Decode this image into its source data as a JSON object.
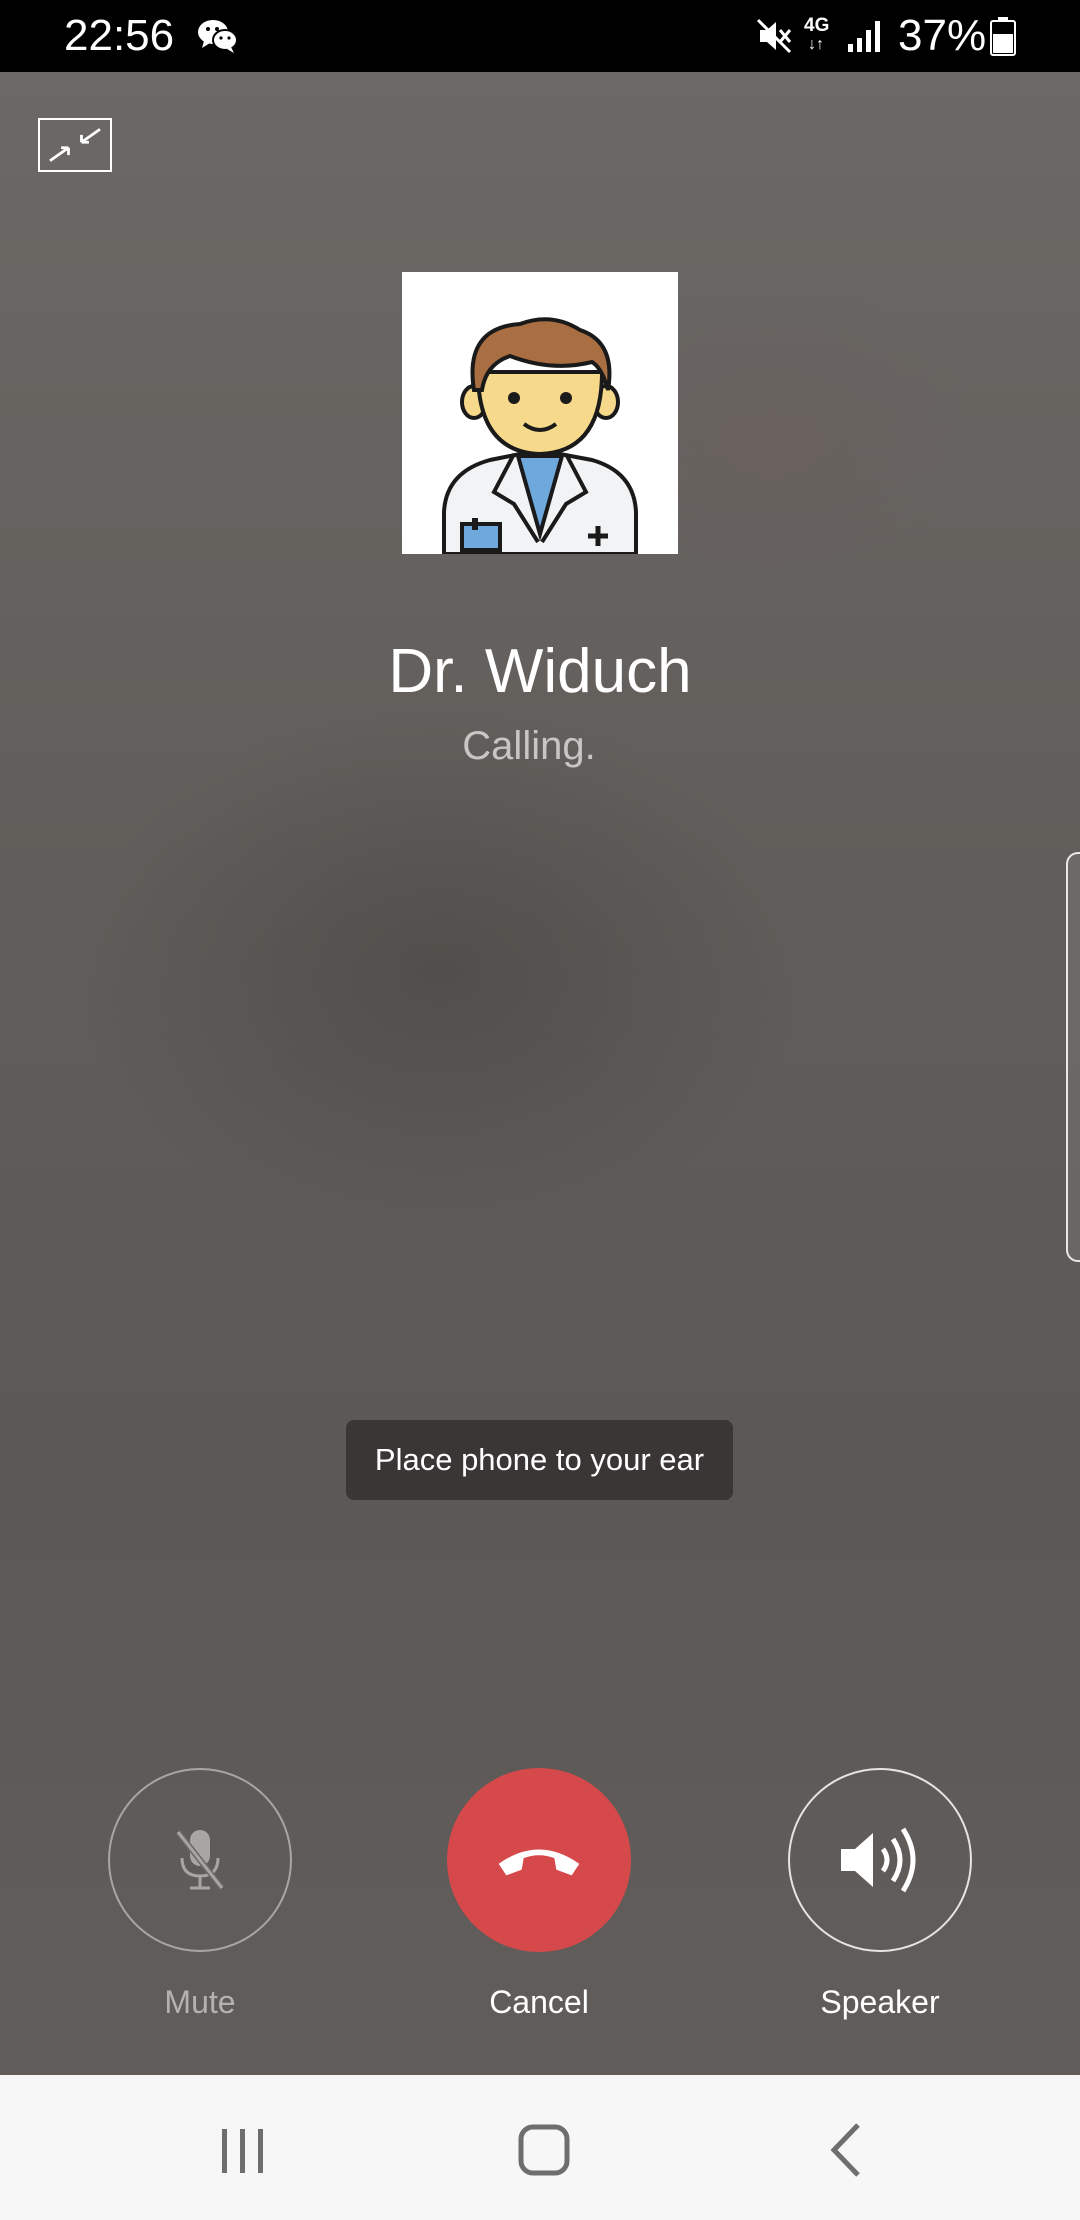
{
  "status_bar": {
    "time": "22:56",
    "network": "4G",
    "network_arrows": "↓↑",
    "battery": "37%",
    "icons": [
      "wechat-icon",
      "mute-icon",
      "signal-icon",
      "battery-icon"
    ]
  },
  "call": {
    "caller_name": "Dr. Widuch",
    "status": "Calling.",
    "toast": "Place phone to your ear",
    "avatar_icon": "doctor-avatar"
  },
  "actions": {
    "mute_label": "Mute",
    "cancel_label": "Cancel",
    "speaker_label": "Speaker",
    "mute_icon": "mic-off-icon",
    "cancel_icon": "hang-up-icon",
    "speaker_icon": "speaker-icon"
  },
  "nav": {
    "icons": [
      "recents-icon",
      "home-icon",
      "back-icon"
    ]
  },
  "colors": {
    "background": "#615d5a",
    "cancel_red": "#d6494a",
    "status_bar": "#000000",
    "nav_bar": "#f7f7f7"
  }
}
